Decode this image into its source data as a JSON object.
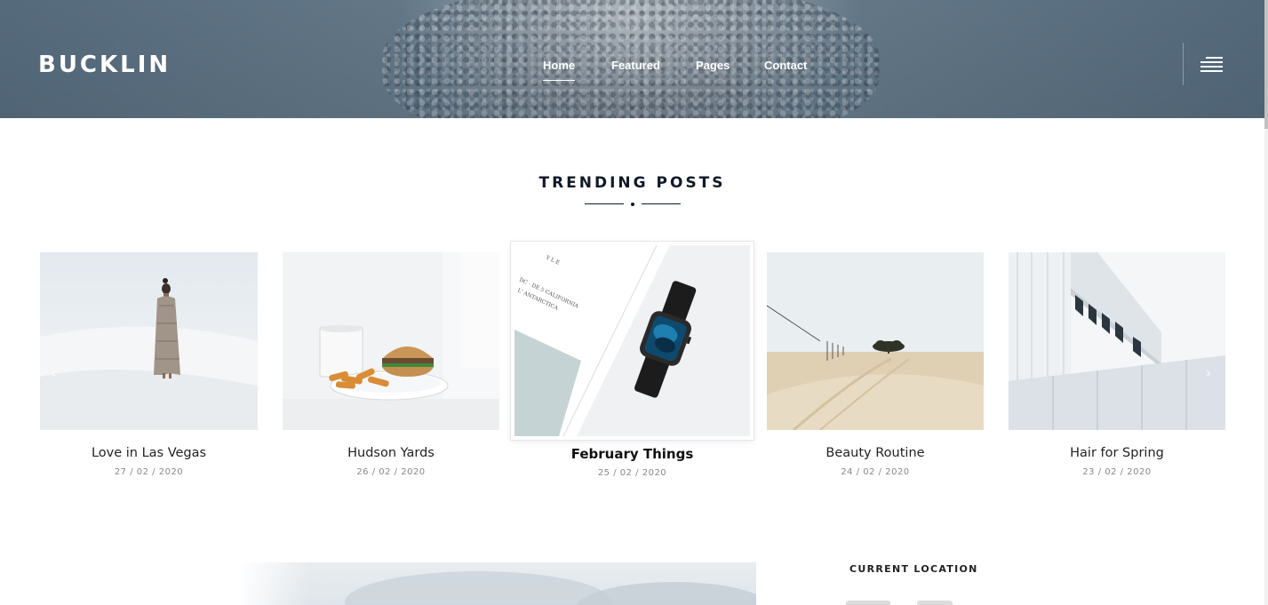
{
  "header": {
    "logo": "BUCKLIN",
    "nav": [
      {
        "label": "Home",
        "active": true
      },
      {
        "label": "Featured",
        "active": false
      },
      {
        "label": "Pages",
        "active": false
      },
      {
        "label": "Contact",
        "active": false
      }
    ],
    "menu_icon": "hamburger-menu-icon"
  },
  "trending": {
    "title": "TRENDING POSTS",
    "posts": [
      {
        "title": "Love in Las Vegas",
        "date": "27  / 02  / 2020"
      },
      {
        "title": "Hudson Yards",
        "date": "26  / 02  / 2020"
      },
      {
        "title": "February Things",
        "date": "25  / 02  / 2020",
        "featured": true
      },
      {
        "title": "Beauty Routine",
        "date": "24  / 02  / 2020"
      },
      {
        "title": "Hair for Spring",
        "date": "23  / 02  / 2020"
      }
    ],
    "prev_icon": "chevron-left-icon",
    "next_icon": "chevron-right-icon"
  },
  "sidebar": {
    "current_location_label": "CURRENT LOCATION"
  },
  "colors": {
    "heading": "#111827",
    "nav_text": "#ffffff",
    "date_text": "#888888"
  }
}
